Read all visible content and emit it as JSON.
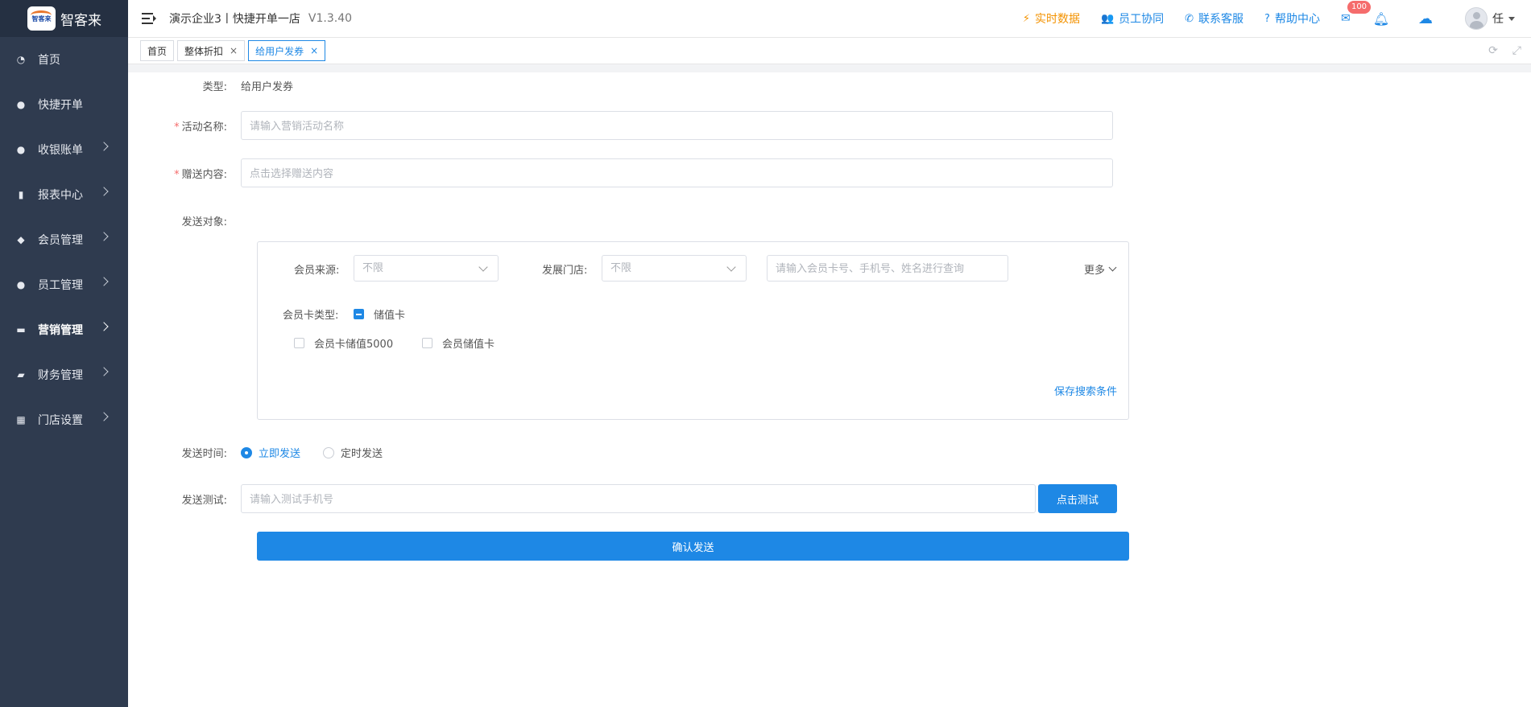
{
  "sidebar": {
    "brand": "智客来",
    "logo_text": "智客来",
    "items": [
      {
        "label": "首页",
        "icon": "dashboard-icon",
        "glyph": "◔",
        "chevron": false
      },
      {
        "label": "快捷开单",
        "icon": "money-bag-icon",
        "glyph": "●",
        "chevron": false
      },
      {
        "label": "收银账单",
        "icon": "money-bag-icon",
        "glyph": "●",
        "chevron": true
      },
      {
        "label": "报表中心",
        "icon": "bar-chart-icon",
        "glyph": "▮",
        "chevron": true
      },
      {
        "label": "会员管理",
        "icon": "diamond-icon",
        "glyph": "◆",
        "chevron": true
      },
      {
        "label": "员工管理",
        "icon": "user-icon",
        "glyph": "●",
        "chevron": true
      },
      {
        "label": "营销管理",
        "icon": "briefcase-icon",
        "glyph": "▬",
        "chevron": true,
        "active": true
      },
      {
        "label": "财务管理",
        "icon": "wallet-icon",
        "glyph": "▰",
        "chevron": true
      },
      {
        "label": "门店设置",
        "icon": "grid-icon",
        "glyph": "▦",
        "chevron": true
      }
    ]
  },
  "header": {
    "store_name": "演示企业3丨快捷开单一店",
    "version": "V1.3.40",
    "links": [
      {
        "label": "实时数据",
        "icon": "trend-icon",
        "glyph": "⚡",
        "color": "#f39200"
      },
      {
        "label": "员工协同",
        "icon": "users-icon",
        "glyph": "👥",
        "color": "#1e88e5"
      },
      {
        "label": "联系客服",
        "icon": "phone-icon",
        "glyph": "✆",
        "color": "#1e88e5"
      },
      {
        "label": "帮助中心",
        "icon": "help-icon",
        "glyph": "?",
        "color": "#1e88e5"
      }
    ],
    "mail_badge": "100",
    "user_name": "任"
  },
  "tabs": [
    {
      "label": "首页",
      "closable": false
    },
    {
      "label": "整体折扣",
      "closable": true
    },
    {
      "label": "给用户发券",
      "closable": true,
      "active": true
    }
  ],
  "form": {
    "type_label": "类型:",
    "type_value": "给用户发券",
    "activity_label": "活动名称:",
    "activity_placeholder": "请输入营销活动名称",
    "gift_label": "赠送内容:",
    "gift_placeholder": "点击选择赠送内容",
    "target_label": "发送对象:",
    "filter": {
      "source_label": "会员来源:",
      "source_value": "不限",
      "store_label": "发展门店:",
      "store_value": "不限",
      "search_placeholder": "请输入会员卡号、手机号、姓名进行查询",
      "more_label": "更多",
      "card_type_label": "会员卡类型:",
      "card_type_parent": "储值卡",
      "card_options": [
        "会员卡储值5000",
        "会员储值卡"
      ],
      "save_link": "保存搜索条件"
    },
    "time_label": "发送时间:",
    "time_options": [
      "立即发送",
      "定时发送"
    ],
    "time_selected": "立即发送",
    "test_label": "发送测试:",
    "test_placeholder": "请输入测试手机号",
    "test_button": "点击测试",
    "confirm_button": "确认发送"
  }
}
